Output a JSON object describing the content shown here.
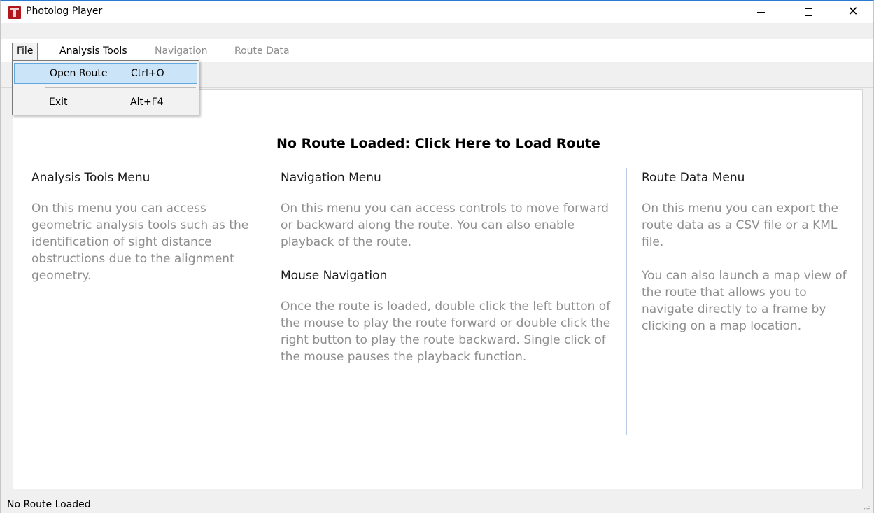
{
  "window": {
    "title": "Photolog Player",
    "minimize_glyph": "",
    "close_glyph": "✕"
  },
  "menu": {
    "file": "File",
    "analysis_tools": "Analysis Tools",
    "navigation": "Navigation",
    "route_data": "Route Data"
  },
  "file_menu": {
    "open_route": {
      "label": "Open Route",
      "shortcut": "Ctrl+O"
    },
    "exit": {
      "label": "Exit",
      "shortcut": "Alt+F4"
    }
  },
  "content": {
    "headline": "No Route Loaded: Click Here to Load Route",
    "analysis": {
      "heading": "Analysis Tools Menu",
      "body": "On this menu you can access geometric analysis tools such as the identification of sight distance obstructions due to the alignment geometry."
    },
    "navigation": {
      "heading": "Navigation Menu",
      "body": "On this menu you can access controls to move forward or backward along the route. You can also enable playback of the route."
    },
    "mouse": {
      "heading": "Mouse Navigation",
      "body": "Once the route is loaded, double click the left button of the mouse to play the route forward or double click the right button to play the route backward. Single click of the mouse pauses the playback function."
    },
    "route_data": {
      "heading": "Route Data Menu",
      "body1": "On this menu you can export the route data as a CSV file or a KML file.",
      "body2": "You can also launch a map view of the route that allows you to navigate directly to a frame by clicking on a map location."
    }
  },
  "status": {
    "text": "No Route Loaded"
  },
  "colors": {
    "accent_border": "#2b79d0",
    "disabled_menu": "#8d8d8d",
    "body_text": "#8e8e8e",
    "highlight": "#cce4f7"
  }
}
